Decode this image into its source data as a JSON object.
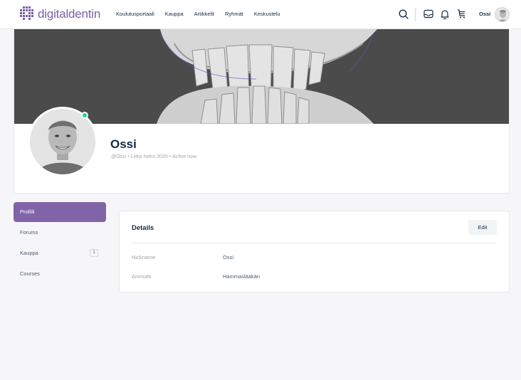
{
  "header": {
    "logo_text": "digitaldentin",
    "nav": [
      "Koulutusportaali",
      "Kauppa",
      "Artikkelit",
      "Ryhmät",
      "Keskustelu"
    ],
    "user_name": "Ossi",
    "icons": [
      "search-icon",
      "inbox-icon",
      "bell-icon",
      "cart-icon"
    ]
  },
  "profile": {
    "name": "Ossi",
    "handle": "@Ossi",
    "joined": "Liittyi helmi 2020",
    "status": "Active now",
    "online": true
  },
  "sidebar": {
    "items": [
      {
        "label": "Profiili",
        "active": true
      },
      {
        "label": "Forums"
      },
      {
        "label": "Kauppa",
        "count": "1"
      },
      {
        "label": "Courses"
      }
    ]
  },
  "details": {
    "title": "Details",
    "edit_label": "Edit",
    "rows": [
      {
        "label": "Nickname",
        "value": "Ossi"
      },
      {
        "label": "Ammatti",
        "value": "Hammaslääkäri"
      }
    ]
  },
  "colors": {
    "accent": "#8164a8",
    "logo": "#7b5ea7",
    "online": "#1cd991",
    "text": "#122b46"
  }
}
